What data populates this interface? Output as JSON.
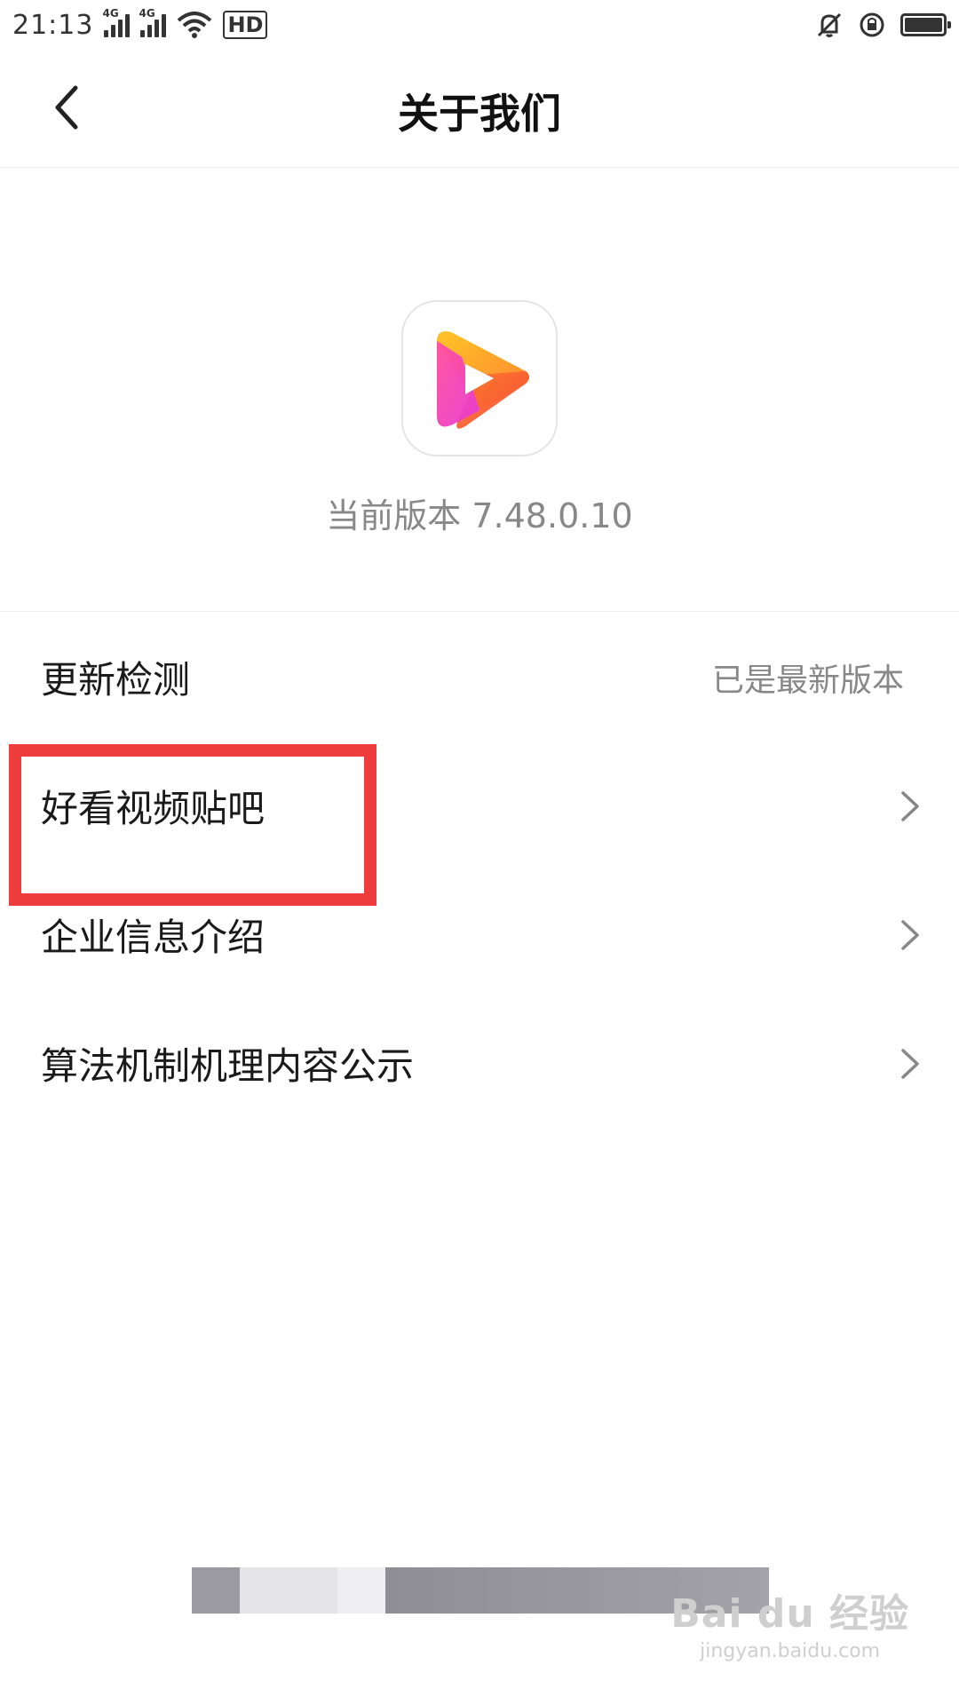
{
  "status_bar": {
    "time": "21:13",
    "network_1": "4G",
    "network_2": "4G",
    "hd_label": "HD",
    "icons": [
      "signal-icon",
      "signal-icon",
      "wifi-icon",
      "hd-icon",
      "mute-bell-icon",
      "rotation-lock-icon",
      "battery-icon"
    ]
  },
  "header": {
    "title": "关于我们",
    "back_icon": "chevron-left-icon"
  },
  "app": {
    "version_text": "当前版本 7.48.0.10",
    "icon": "haokan-logo-icon",
    "colors": {
      "yellow": "#FFC21A",
      "orange": "#FF7A2A",
      "red": "#F24A3B",
      "magenta": "#F23AC8"
    }
  },
  "list": [
    {
      "label": "更新检测",
      "value": "已是最新版本",
      "has_chevron": false
    },
    {
      "label": "好看视频贴吧",
      "value": "",
      "has_chevron": true
    },
    {
      "label": "企业信息介绍",
      "value": "",
      "has_chevron": true
    },
    {
      "label": "算法机制机理内容公示",
      "value": "",
      "has_chevron": true
    }
  ],
  "highlight_color": "#EE3B3B",
  "watermark": {
    "main": "Bai du 经验",
    "sub": "jingyan.baidu.com"
  }
}
